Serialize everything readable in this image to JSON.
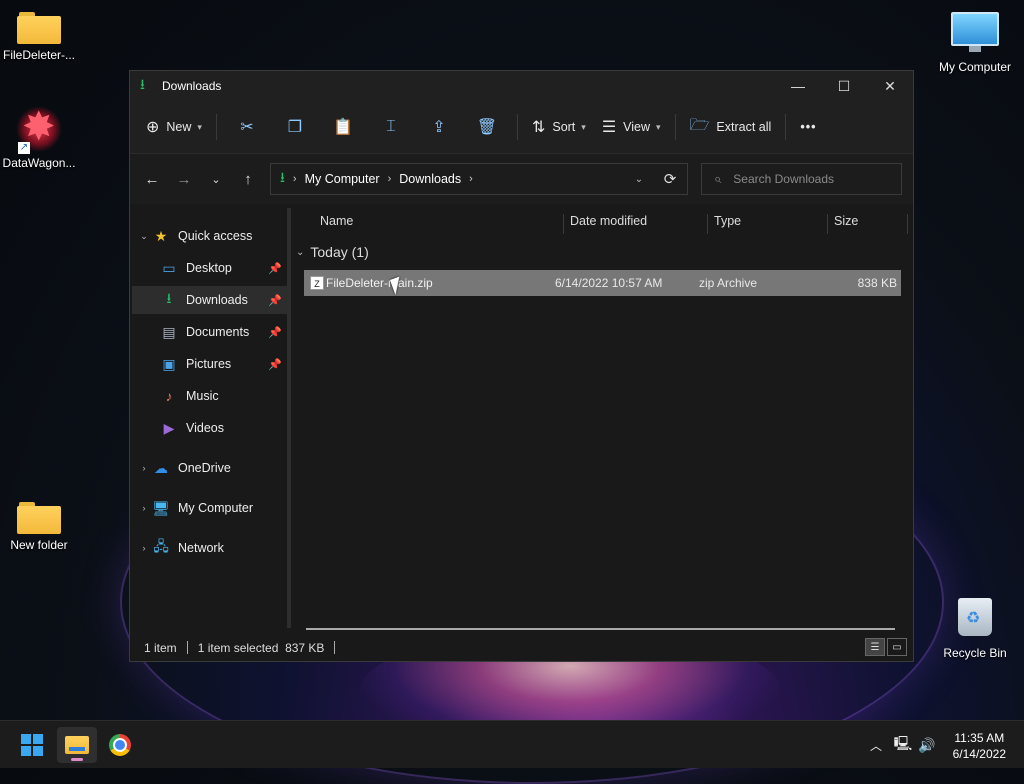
{
  "desktop": {
    "icons": [
      {
        "label": "FileDeleter-...",
        "icon": "folder-icon"
      },
      {
        "label": "DataWagon...",
        "icon": "datawagon-app-icon"
      },
      {
        "label": "New folder",
        "icon": "folder-icon"
      },
      {
        "label": "My Computer",
        "icon": "monitor-icon"
      },
      {
        "label": "Recycle Bin",
        "icon": "recycle-bin-icon"
      }
    ]
  },
  "window": {
    "title": "Downloads",
    "controls": {
      "minimize": "—",
      "maximize": "☐",
      "close": "✕"
    }
  },
  "toolbar": {
    "new_label": "New",
    "sort_label": "Sort",
    "view_label": "View",
    "extract_label": "Extract all",
    "more_label": "•••"
  },
  "address": {
    "crumbs": [
      "My Computer",
      "Downloads"
    ]
  },
  "search": {
    "placeholder": "Search Downloads"
  },
  "sidebar": {
    "quick_access": "Quick access",
    "items": [
      {
        "label": "Desktop",
        "pinned": true
      },
      {
        "label": "Downloads",
        "pinned": true
      },
      {
        "label": "Documents",
        "pinned": true
      },
      {
        "label": "Pictures",
        "pinned": true
      },
      {
        "label": "Music",
        "pinned": false
      },
      {
        "label": "Videos",
        "pinned": false
      }
    ],
    "onedrive": "OneDrive",
    "my_computer": "My Computer",
    "network": "Network"
  },
  "columns": {
    "name": "Name",
    "date": "Date modified",
    "type": "Type",
    "size": "Size"
  },
  "group": {
    "label": "Today (1)"
  },
  "files": [
    {
      "name": "FileDeleter-main.zip",
      "date": "6/14/2022 10:57 AM",
      "type": "zip Archive",
      "size": "838 KB"
    }
  ],
  "status": {
    "count": "1 item",
    "selected": "1 item selected  837 KB"
  },
  "taskbar": {
    "time": "11:35 AM",
    "date": "6/14/2022"
  },
  "colors": {
    "accent_green": "#22c36b",
    "selection": "#777777",
    "window_bg": "#191919"
  }
}
